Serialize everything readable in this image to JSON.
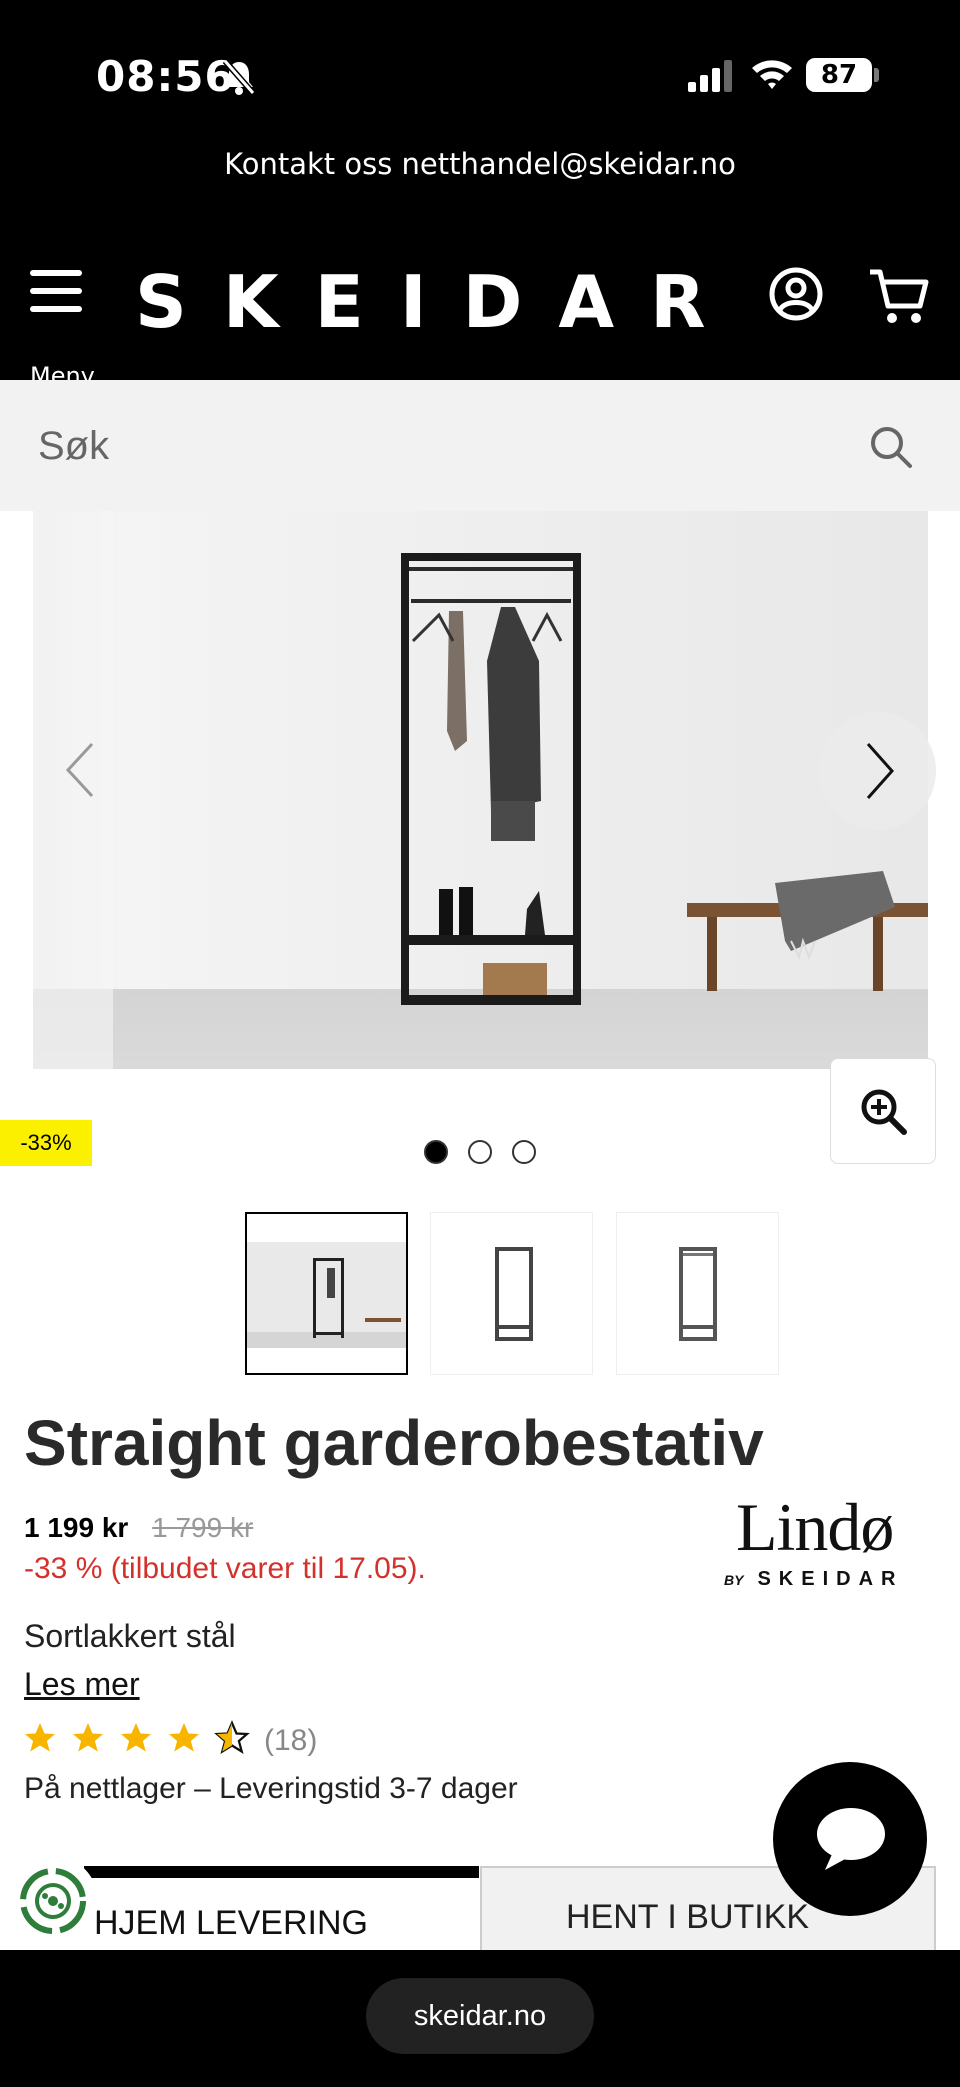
{
  "status_bar": {
    "time": "08:56",
    "battery": "87"
  },
  "contact": {
    "text": "Kontakt oss netthandel@skeidar.no"
  },
  "header": {
    "menu_label": "Meny",
    "logo": "SKEIDAR"
  },
  "search": {
    "placeholder": "Søk"
  },
  "gallery": {
    "discount_badge": "-33%",
    "image_count": 3,
    "active_index": 0
  },
  "product": {
    "title": "Straight garderobestativ",
    "price": "1 199 kr",
    "old_price": "1 799 kr",
    "offer": "-33 % (tilbudet varer til 17.05).",
    "material": "Sortlakkert stål",
    "read_more": "Les mer",
    "rating": 4.5,
    "review_count": "(18)",
    "stock": "På nettlager – Leveringstid 3-7 dager"
  },
  "brand": {
    "name": "Lindø",
    "by": "BY",
    "sub": "SKEIDAR"
  },
  "delivery_tabs": {
    "home": "HJEM LEVERING",
    "store": "HENT I BUTIKK"
  },
  "browser": {
    "url": "skeidar.no"
  },
  "colors": {
    "accent_red": "#d3312c",
    "badge_yellow": "#fbf000",
    "header_bg": "#000000",
    "star": "#f7b500"
  },
  "icons": [
    "bell-slash-icon",
    "signal-icon",
    "wifi-icon",
    "battery-icon",
    "menu-icon",
    "user-icon",
    "cart-icon",
    "search-icon",
    "chevron-left-icon",
    "chevron-right-icon",
    "zoom-in-icon",
    "star-icon",
    "chat-icon",
    "eco-icon"
  ]
}
